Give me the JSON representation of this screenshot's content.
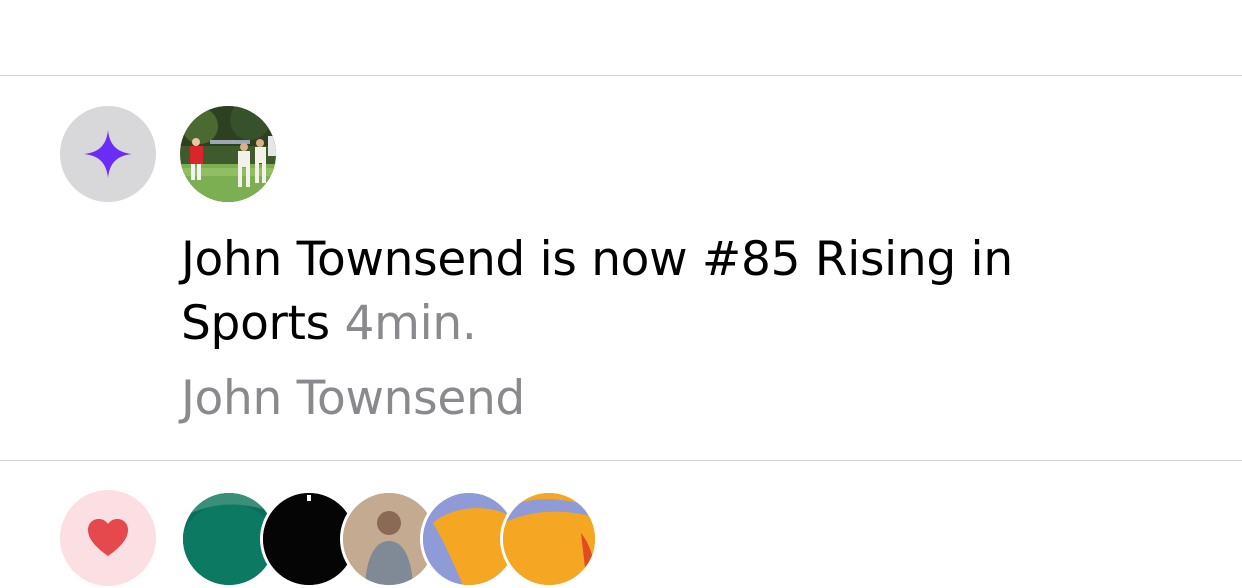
{
  "colors": {
    "divider": "#d1d1d6",
    "secondary_text": "#8a8a8e",
    "rising_icon_bg": "#d8d8da",
    "rising_icon_fg": "#6b2cf5",
    "like_icon_bg": "#fcdfe2",
    "like_icon_fg": "#e5484d"
  },
  "notification": {
    "icon": "sparkle-icon",
    "avatar": "cricket-photo-avatar",
    "message": "John Townsend is now #85 Rising in Sports",
    "time": "4min.",
    "subtitle": "John Townsend"
  },
  "next_notification": {
    "icon": "heart-icon",
    "avatars": [
      "green-avatar",
      "black-avatar",
      "person-avatar",
      "periwinkle-orange-avatar",
      "orange-avatar"
    ]
  }
}
